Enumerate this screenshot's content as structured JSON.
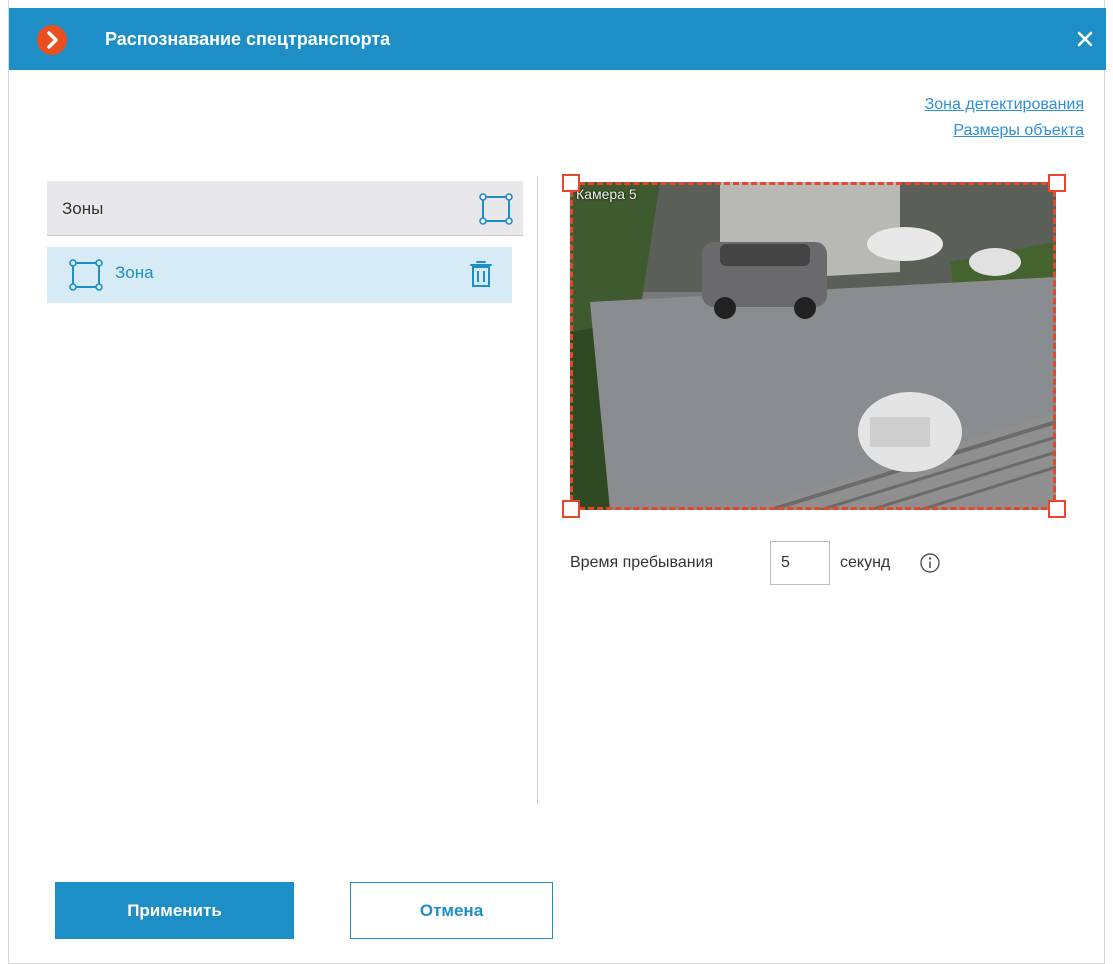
{
  "window": {
    "title": "Распознавание спецтранспорта"
  },
  "links": {
    "detection_zone": "Зона детектирования",
    "object_size": "Размеры объекта"
  },
  "zones": {
    "header": "Зоны",
    "items": [
      {
        "label": "Зона"
      }
    ]
  },
  "preview": {
    "camera_label": "Камера 5"
  },
  "dwell": {
    "label": "Время пребывания",
    "value": "5",
    "unit": "секунд"
  },
  "buttons": {
    "apply": "Применить",
    "cancel": "Отмена"
  },
  "colors": {
    "accent": "#1e8fc6",
    "zone_outline": "#e8452c",
    "logo": "#ea4f1f",
    "selection": "#d7ebf6"
  }
}
